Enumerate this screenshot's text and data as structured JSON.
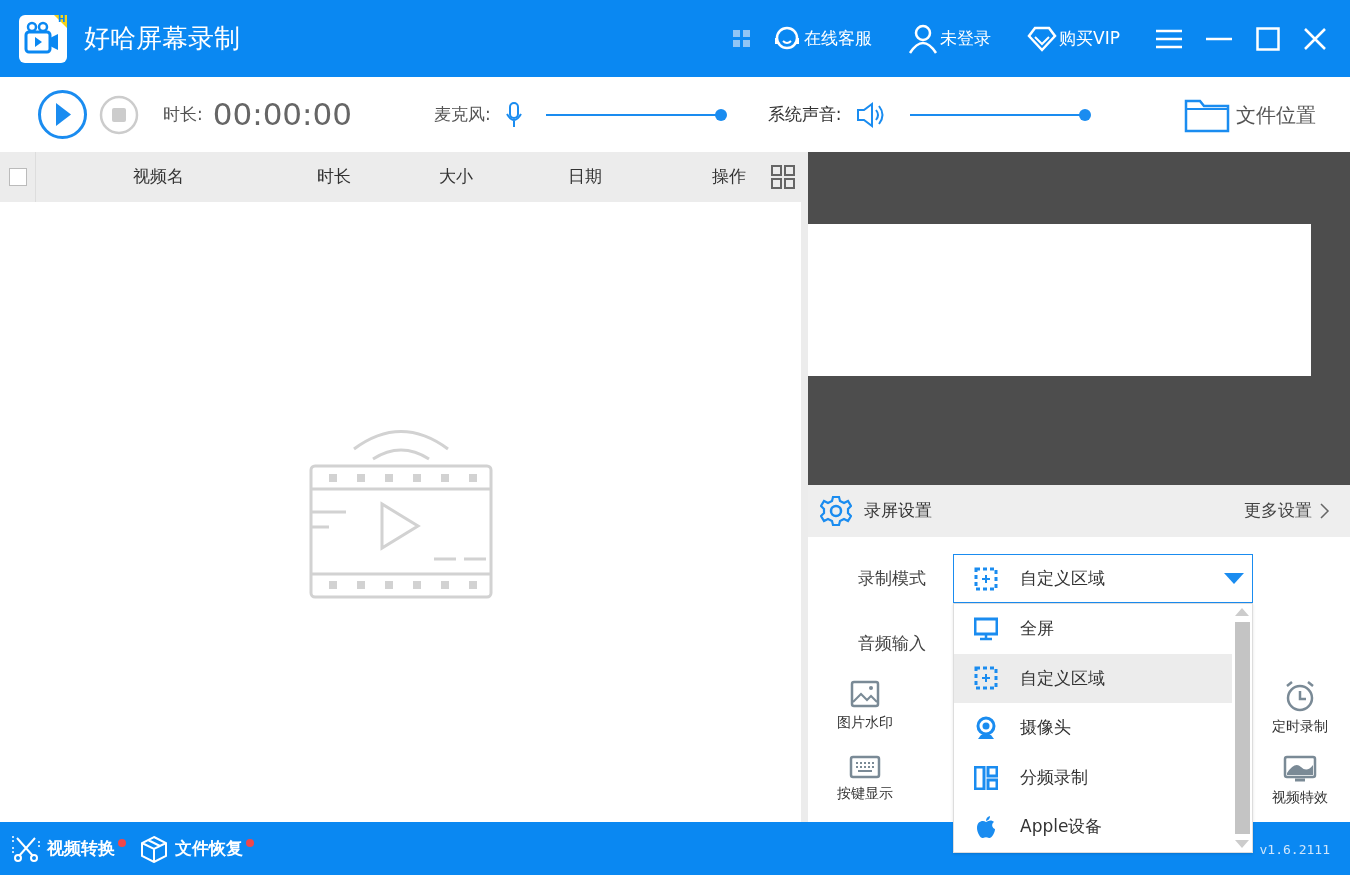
{
  "app": {
    "title": "好哈屏幕录制",
    "badge": "H",
    "links": [
      {
        "kind": "qr"
      },
      {
        "kind": "service",
        "label": "在线客服"
      },
      {
        "kind": "user",
        "label": "未登录"
      },
      {
        "kind": "vip",
        "label": "购买VIP"
      }
    ]
  },
  "toolbar": {
    "duration_label": "时长:",
    "duration": "00:00:00",
    "mic": {
      "label": "麦克风:",
      "level": 1.0
    },
    "system": {
      "label": "系统声音:",
      "level": 1.0
    },
    "folder": "文件位置"
  },
  "table": {
    "columns": [
      "视频名",
      "时长",
      "大小",
      "日期",
      "操作"
    ],
    "checked": false
  },
  "settings": {
    "title": "录屏设置",
    "more": "更多设置",
    "mode_label": "录制模式",
    "mode_value": "自定义区域",
    "audio_label": "音频输入",
    "tools": [
      {
        "kind": "image",
        "label": "图片水印"
      },
      {
        "kind": "keyboard",
        "label": "按键显示"
      },
      {
        "kind": "clock",
        "label": "定时录制"
      },
      {
        "kind": "monitor",
        "label": "视频特效"
      }
    ],
    "options": [
      {
        "kind": "monitor",
        "label": "全屏",
        "selected": false
      },
      {
        "kind": "region",
        "label": "自定义区域",
        "selected": true
      },
      {
        "kind": "camera",
        "label": "摄像头",
        "selected": false
      },
      {
        "kind": "split",
        "label": "分频录制",
        "selected": false
      },
      {
        "kind": "apple",
        "label": "Apple设备",
        "selected": false
      }
    ]
  },
  "footer": {
    "items": [
      {
        "kind": "convert",
        "label": "视频转换",
        "dot": true
      },
      {
        "kind": "recover",
        "label": "文件恢复",
        "dot": true
      }
    ],
    "version": "v1.6.2111"
  }
}
